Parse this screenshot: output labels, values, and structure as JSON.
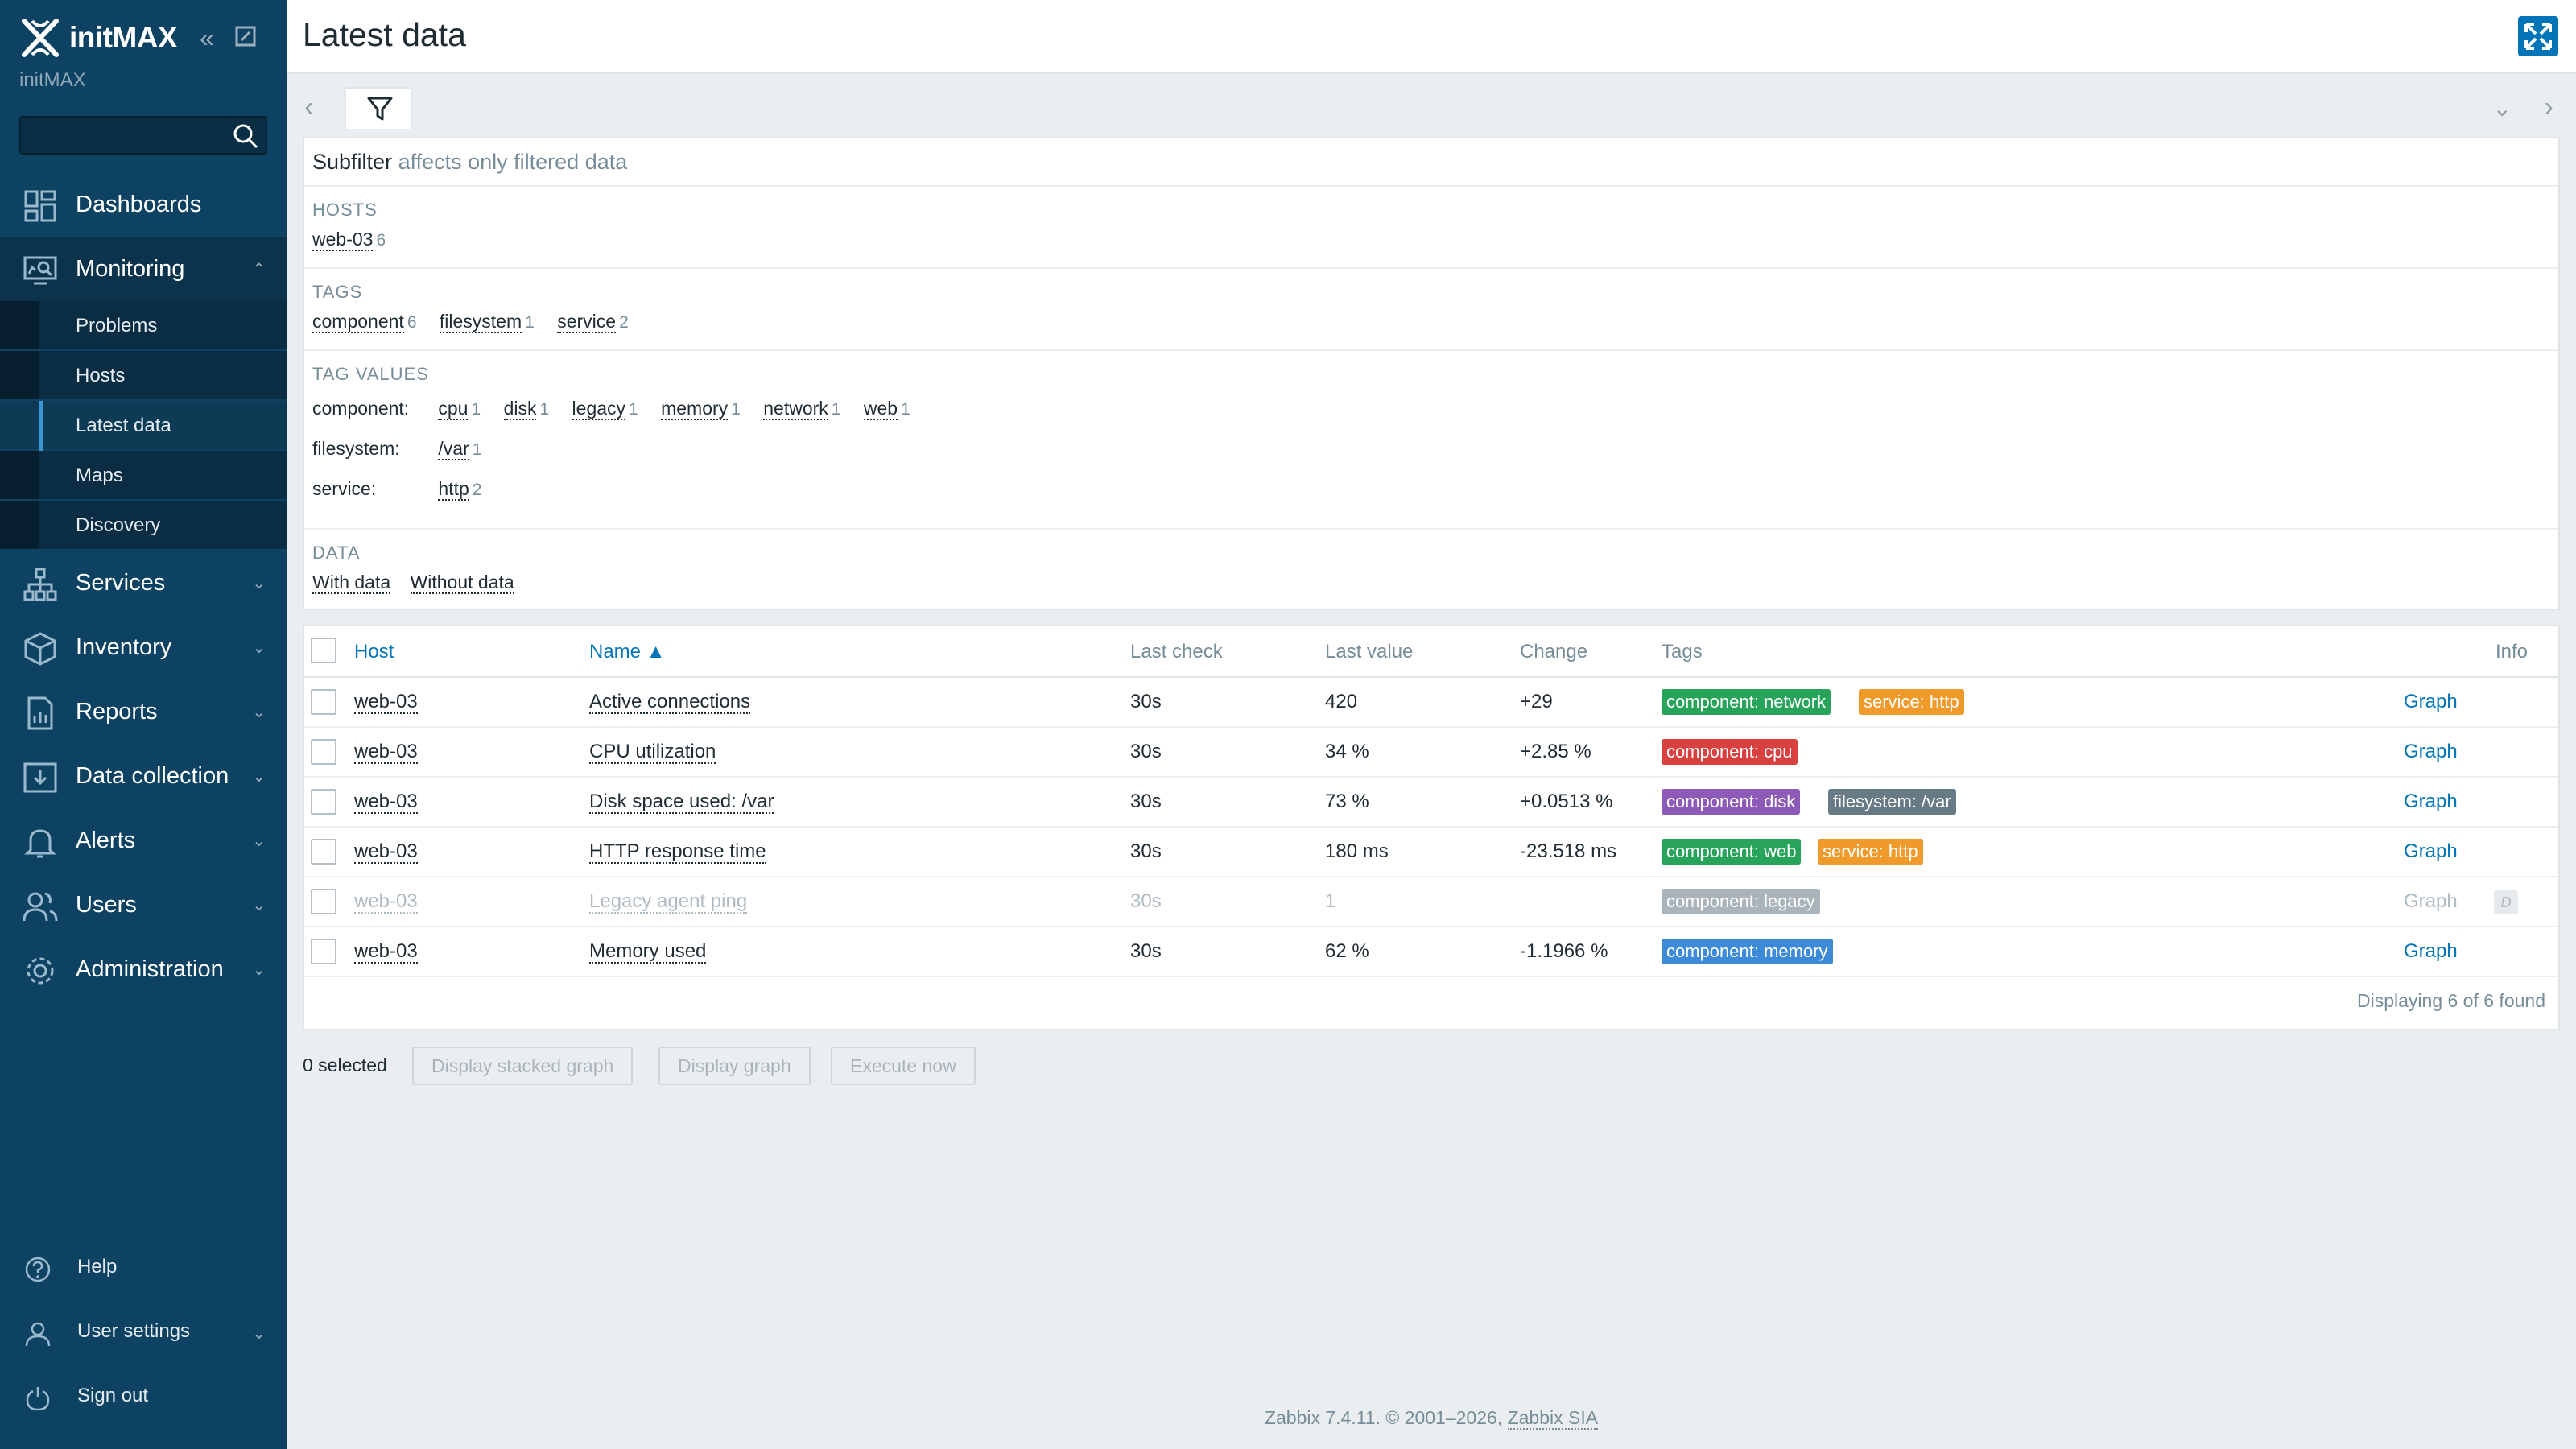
{
  "sidebar": {
    "logo_text": "initMAX",
    "org_name": "initMAX",
    "search": {
      "value": "",
      "placeholder": ""
    },
    "menu": [
      {
        "label": "Dashboards",
        "icon": "dashboard-icon"
      },
      {
        "label": "Monitoring",
        "icon": "monitoring-icon",
        "open": true,
        "items": [
          "Problems",
          "Hosts",
          "Latest data",
          "Maps",
          "Discovery"
        ],
        "active": "Latest data"
      },
      {
        "label": "Services",
        "icon": "services-icon"
      },
      {
        "label": "Inventory",
        "icon": "inventory-icon"
      },
      {
        "label": "Reports",
        "icon": "reports-icon"
      },
      {
        "label": "Data collection",
        "icon": "data-collection-icon"
      },
      {
        "label": "Alerts",
        "icon": "bell-icon"
      },
      {
        "label": "Users",
        "icon": "users-icon"
      },
      {
        "label": "Administration",
        "icon": "gear-icon"
      }
    ],
    "bottom": [
      {
        "label": "Help",
        "icon": "help-icon"
      },
      {
        "label": "User settings",
        "icon": "user-icon"
      },
      {
        "label": "Sign out",
        "icon": "power-icon"
      }
    ]
  },
  "page": {
    "title": "Latest data"
  },
  "subfilter": {
    "title": "Subfilter",
    "title_note": "affects only filtered data",
    "hosts_head": "HOSTS",
    "hosts": [
      {
        "name": "web-03",
        "count": "6"
      }
    ],
    "tags_head": "TAGS",
    "tags": [
      {
        "name": "component",
        "count": "6"
      },
      {
        "name": "filesystem",
        "count": "1"
      },
      {
        "name": "service",
        "count": "2"
      }
    ],
    "tag_values_head": "TAG VALUES",
    "tag_values": {
      "component_label": "component:",
      "component": [
        {
          "name": "cpu",
          "count": "1"
        },
        {
          "name": "disk",
          "count": "1"
        },
        {
          "name": "legacy",
          "count": "1"
        },
        {
          "name": "memory",
          "count": "1"
        },
        {
          "name": "network",
          "count": "1"
        },
        {
          "name": "web",
          "count": "1"
        }
      ],
      "filesystem_label": "filesystem:",
      "filesystem": [
        {
          "name": "/var",
          "count": "1"
        }
      ],
      "service_label": "service:",
      "service": [
        {
          "name": "http",
          "count": "2"
        }
      ]
    },
    "data_head": "DATA",
    "data_options": [
      "With data",
      "Without data"
    ]
  },
  "table": {
    "columns": {
      "host": "Host",
      "name": "Name ▲",
      "last_check": "Last check",
      "last_value": "Last value",
      "change": "Change",
      "tags": "Tags",
      "info": "Info"
    },
    "rows": [
      {
        "host": "web-03",
        "name": "Active connections",
        "last_check": "30s",
        "last_value": "420",
        "change": "+29",
        "tags": [
          {
            "text": "component: network",
            "color": "#27a35a"
          },
          {
            "text": "service: http",
            "color": "#f09a2b"
          }
        ],
        "graph": "Graph"
      },
      {
        "host": "web-03",
        "name": "CPU utilization",
        "last_check": "30s",
        "last_value": "34 %",
        "change": "+2.85 %",
        "tags": [
          {
            "text": "component: cpu",
            "color": "#d94040"
          }
        ],
        "graph": "Graph"
      },
      {
        "host": "web-03",
        "name": "Disk space used: /var",
        "last_check": "30s",
        "last_value": "73 %",
        "change": "+0.0513 %",
        "tags": [
          {
            "text": "component: disk",
            "color": "#8e5ab8"
          },
          {
            "text": "filesystem: /var",
            "color": "#687a85"
          }
        ],
        "graph": "Graph"
      },
      {
        "host": "web-03",
        "name": "HTTP response time",
        "last_check": "30s",
        "last_value": "180 ms",
        "change": "-23.518 ms",
        "tags": [
          {
            "text": "component: web",
            "color": "#27a35a"
          },
          {
            "text": "service: http",
            "color": "#f09a2b"
          }
        ],
        "graph": "Graph"
      },
      {
        "host": "web-03",
        "name": "Legacy agent ping",
        "last_check": "30s",
        "last_value": "1",
        "change": "",
        "tags": [
          {
            "text": "component: legacy",
            "color": "#aab4ba"
          }
        ],
        "graph": "Graph",
        "disabled": true,
        "info": "D"
      },
      {
        "host": "web-03",
        "name": "Memory used",
        "last_check": "30s",
        "last_value": "62 %",
        "change": "-1.1966 %",
        "tags": [
          {
            "text": "component: memory",
            "color": "#3d8ad8"
          }
        ],
        "graph": "Graph"
      }
    ],
    "displaying": "Displaying 6 of 6 found"
  },
  "actions": {
    "selected": "0 selected",
    "buttons": [
      "Display stacked graph",
      "Display graph",
      "Execute now"
    ]
  },
  "footer": {
    "text": "Zabbix 7.4.11. © 2001–2026, ",
    "link": "Zabbix SIA"
  }
}
